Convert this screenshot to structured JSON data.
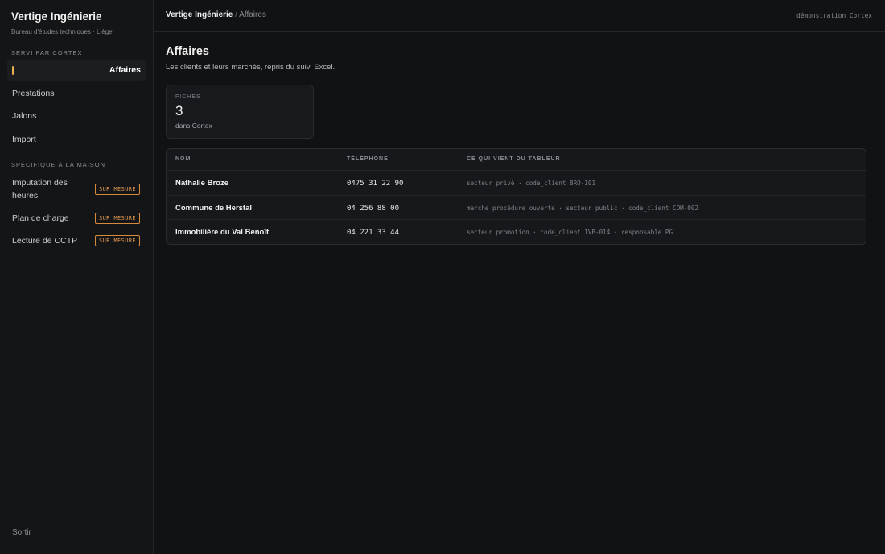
{
  "sidebar": {
    "brand_title": "Vertige Ingénierie",
    "brand_subtitle": "Bureau d'études techniques · Liège",
    "section_cortex": "SERVI PAR CORTEX",
    "items": [
      {
        "label": "Affaires",
        "active": true
      },
      {
        "label": "Prestations"
      },
      {
        "label": "Jalons"
      },
      {
        "label": "Import"
      }
    ],
    "section_custom": "SPÉCIFIQUE À LA MAISON",
    "custom_items": [
      {
        "label_line1": "Imputation des",
        "label_line2": "heures",
        "badge": "SUR MESURE"
      },
      {
        "label": "Plan de charge",
        "badge": "SUR MESURE"
      },
      {
        "label": "Lecture de CCTP",
        "badge": "SUR MESURE"
      }
    ],
    "logout": "Sortir"
  },
  "topbar": {
    "crumb_root": "Vertige Ingénierie",
    "crumb_sep": " / ",
    "crumb_current": "Affaires",
    "demo": "démonstration Cortex"
  },
  "page": {
    "title": "Affaires",
    "subtitle": "Les clients et leurs marchés, repris du suivi Excel."
  },
  "stat": {
    "label": "FICHES",
    "value": "3",
    "caption": "dans Cortex"
  },
  "table": {
    "headers": [
      "NOM",
      "TÉLÉPHONE",
      "CE QUI VIENT DU TABLEUR"
    ],
    "rows": [
      {
        "name": "Nathalie Broze",
        "phone": "0475 31 22 90",
        "meta": "secteur privé · code_client BRO-101"
      },
      {
        "name": "Commune de Herstal",
        "phone": "04 256 88 00",
        "meta": "marche procédure ouverte · secteur public · code_client COM-002"
      },
      {
        "name": "Immobilière du Val Benoît",
        "phone": "04 221 33 44",
        "meta": "secteur promotion · code_client IVB-014 · responsable PG"
      }
    ]
  },
  "colors": {
    "accent": "#e8b24c",
    "badge": "#e39a52",
    "background": "#111214"
  }
}
